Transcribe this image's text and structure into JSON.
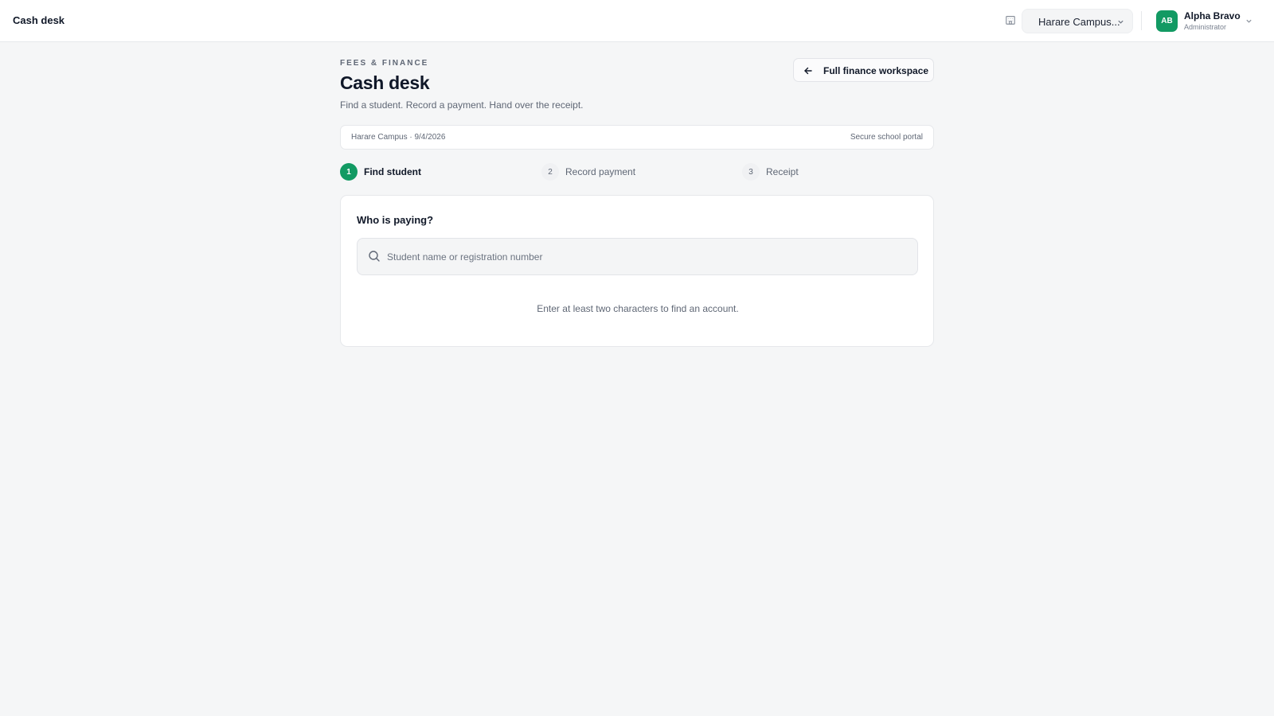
{
  "header": {
    "app_title": "Cash desk",
    "campus_selected": "Harare Campus...",
    "user": {
      "initials": "AB",
      "name": "Alpha Bravo",
      "role": "Administrator"
    }
  },
  "page": {
    "eyebrow": "FEES & FINANCE",
    "title": "Cash desk",
    "subtitle": "Find a student. Record a payment. Hand over the receipt.",
    "back_button_label": "Full finance workspace"
  },
  "info_bar": {
    "left": "Harare Campus · 9/4/2026",
    "right": "Secure school portal"
  },
  "steps": [
    {
      "num": "1",
      "label": "Find student",
      "state": "active"
    },
    {
      "num": "2",
      "label": "Record payment",
      "state": "idle"
    },
    {
      "num": "3",
      "label": "Receipt",
      "state": "idle"
    }
  ],
  "card": {
    "question": "Who is paying?",
    "search_placeholder": "Student name or registration number",
    "search_value": "",
    "hint": "Enter at least two characters to find an account."
  },
  "colors": {
    "accent": "#129a63",
    "background": "#f5f6f7"
  }
}
